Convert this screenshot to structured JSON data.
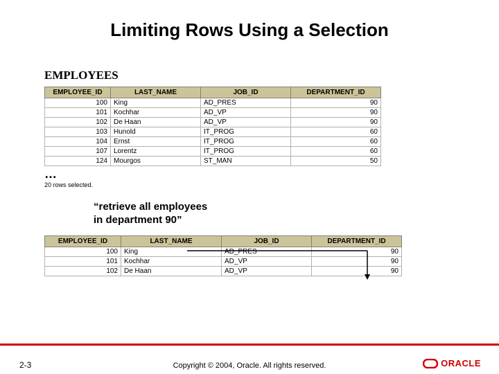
{
  "title": "Limiting Rows Using a Selection",
  "section_label": "EMPLOYEES",
  "table1": {
    "headers": [
      "EMPLOYEE_ID",
      "LAST_NAME",
      "JOB_ID",
      "DEPARTMENT_ID"
    ],
    "rows": [
      {
        "id": "100",
        "name": "King",
        "job": "AD_PRES",
        "dept": "90"
      },
      {
        "id": "101",
        "name": "Kochhar",
        "job": "AD_VP",
        "dept": "90"
      },
      {
        "id": "102",
        "name": "De Haan",
        "job": "AD_VP",
        "dept": "90"
      },
      {
        "id": "103",
        "name": "Hunold",
        "job": "IT_PROG",
        "dept": "60"
      },
      {
        "id": "104",
        "name": "Ernst",
        "job": "IT_PROG",
        "dept": "60"
      },
      {
        "id": "107",
        "name": "Lorentz",
        "job": "IT_PROG",
        "dept": "60"
      },
      {
        "id": "124",
        "name": "Mourgos",
        "job": "ST_MAN",
        "dept": "50"
      }
    ]
  },
  "ellipsis": "…",
  "rowcount": "20 rows selected.",
  "quote": "“retrieve all employees in department 90”",
  "table2": {
    "headers": [
      "EMPLOYEE_ID",
      "LAST_NAME",
      "JOB_ID",
      "DEPARTMENT_ID"
    ],
    "rows": [
      {
        "id": "100",
        "name": "King",
        "job": "AD_PRES",
        "dept": "90"
      },
      {
        "id": "101",
        "name": "Kochhar",
        "job": "AD_VP",
        "dept": "90"
      },
      {
        "id": "102",
        "name": "De Haan",
        "job": "AD_VP",
        "dept": "90"
      }
    ]
  },
  "footer": {
    "page": "2-3",
    "copyright": "Copyright © 2004, Oracle.  All rights reserved.",
    "logo_text": "ORACLE"
  },
  "colors": {
    "header_bg": "#ccc499",
    "accent_red": "#c00000"
  }
}
